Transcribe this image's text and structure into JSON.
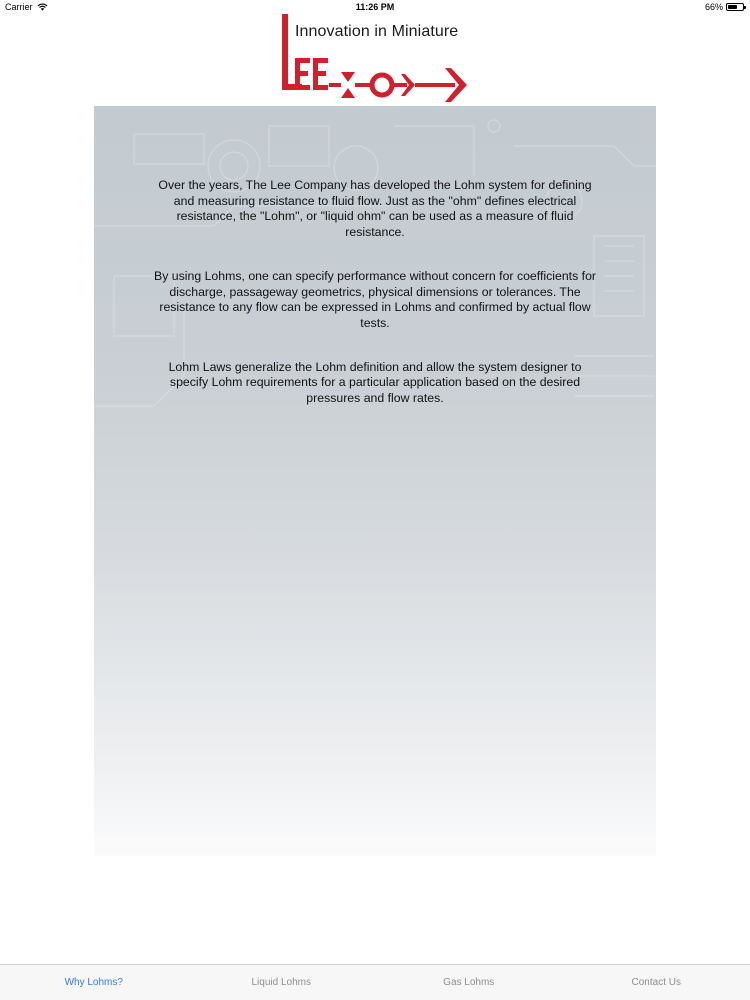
{
  "status_bar": {
    "carrier": "Carrier",
    "time": "11:26 PM",
    "battery": "66%",
    "battery_level": 0.66
  },
  "logo": {
    "tagline": "Innovation in Miniature",
    "brand_color": "#d0202e"
  },
  "content": {
    "paragraphs": [
      "Over the years, The Lee Company has developed the Lohm system for defining and measuring resistance to fluid flow.  Just as the \"ohm\" defines electrical resistance, the \"Lohm\", or \"liquid ohm\" can be used as a measure of fluid resistance.",
      "By using Lohms, one can specify performance without concern for coefficients for discharge, passageway geometrics, physical dimensions or tolerances.  The resistance to any flow can be expressed in Lohms and confirmed by actual flow tests.",
      "Lohm Laws generalize the Lohm definition and allow the system designer to specify Lohm requirements for a particular application based on the desired pressures and flow rates."
    ]
  },
  "tab_bar": {
    "active_color": "#3478f6",
    "inactive_color": "#8e8e93",
    "tabs": [
      {
        "label": "Why Lohms?",
        "active": true
      },
      {
        "label": "Liquid Lohms",
        "active": false
      },
      {
        "label": "Gas Lohms",
        "active": false
      },
      {
        "label": "Contact Us",
        "active": false
      }
    ]
  }
}
